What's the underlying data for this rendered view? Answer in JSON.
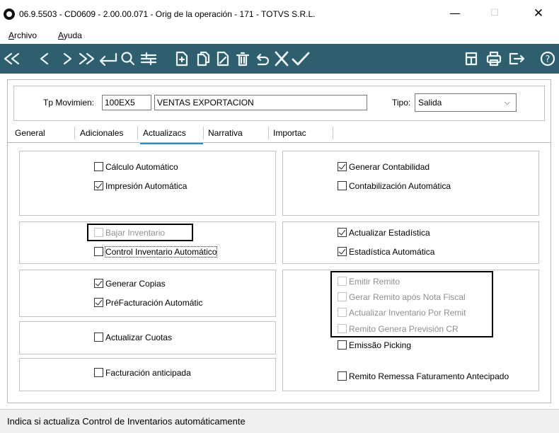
{
  "window": {
    "title": "06.9.5503 - CD0609 - 2.00.00.071 - Orig de la operación - 171 - TOTVS S.R.L.",
    "controls": {
      "minimize": "—",
      "maximize": "☐",
      "close": "✕"
    }
  },
  "menu": {
    "archivo": "Archivo",
    "ayuda": "Ayuda"
  },
  "toolbar": {
    "first": "«",
    "prev": "‹",
    "next": "›",
    "last": "»",
    "enter": "↵",
    "search": "🔍",
    "filter": "≡",
    "new": "+",
    "copy": "⎘",
    "edit": "✎",
    "delete": "🗑",
    "undo": "↶",
    "cancel": "✕",
    "confirm": "✓",
    "calc": "▦",
    "print": "⎙",
    "exit": "⇥",
    "help": "?",
    "colors": {
      "bar": "#2d5f6e",
      "icon": "#f2f7f8"
    }
  },
  "header": {
    "tp_mov_label": "Tp Movimien:",
    "tp_mov_code": "100EX5",
    "tp_mov_desc": "VENTAS EXPORTACION",
    "tipo_label": "Tipo:",
    "tipo_value": "Salida"
  },
  "tabs": [
    {
      "label": "General"
    },
    {
      "label": "Adicionales"
    },
    {
      "label": "Actualizacs"
    },
    {
      "label": "Narrativa"
    },
    {
      "label": "Importac"
    }
  ],
  "active_tab": "Actualizacs",
  "checkboxes": {
    "calculo_auto": {
      "label": "Cálculo Automático",
      "checked": false,
      "enabled": true
    },
    "impresion_auto": {
      "label": "Impresión Automática",
      "checked": true,
      "enabled": true
    },
    "generar_contab": {
      "label": "Generar Contabilidad",
      "checked": true,
      "enabled": true
    },
    "contab_auto": {
      "label": "Contabilización Automática",
      "checked": false,
      "enabled": true
    },
    "bajar_inv": {
      "label": "Bajar Inventario",
      "checked": false,
      "enabled": false
    },
    "control_inv_auto": {
      "label": "Control Inventario Automático",
      "checked": false,
      "enabled": true
    },
    "act_estadistica": {
      "label": "Actualizar Estadística",
      "checked": true,
      "enabled": true
    },
    "estadistica_auto": {
      "label": "Estadística Automática",
      "checked": true,
      "enabled": true
    },
    "generar_copias": {
      "label": "Generar Copias",
      "checked": true,
      "enabled": true
    },
    "prefacturacion": {
      "label": "PréFacturación Automátic",
      "checked": true,
      "enabled": true
    },
    "emitir_remito": {
      "label": "Emitir Remito",
      "checked": false,
      "enabled": false
    },
    "gerar_remito": {
      "label": "Gerar Remito após Nota Fiscal",
      "checked": false,
      "enabled": false
    },
    "act_inv_remito": {
      "label": "Actualizar Inventario Por Remit",
      "checked": false,
      "enabled": false
    },
    "remito_prevision": {
      "label": "Remito Genera Previsión CR",
      "checked": false,
      "enabled": false
    },
    "emissao_picking": {
      "label": "Emissão Picking",
      "checked": false,
      "enabled": true
    },
    "actualizar_cuotas": {
      "label": "Actualizar Cuotas",
      "checked": false,
      "enabled": true
    },
    "facturacion_anticipada": {
      "label": "Facturación anticipada",
      "checked": false,
      "enabled": true
    },
    "remito_remessa": {
      "label": "Remito Remessa Faturamento Antecipado",
      "checked": false,
      "enabled": true
    }
  },
  "status": {
    "text": "Indica si actualiza Control de Inventarios automáticamente"
  }
}
